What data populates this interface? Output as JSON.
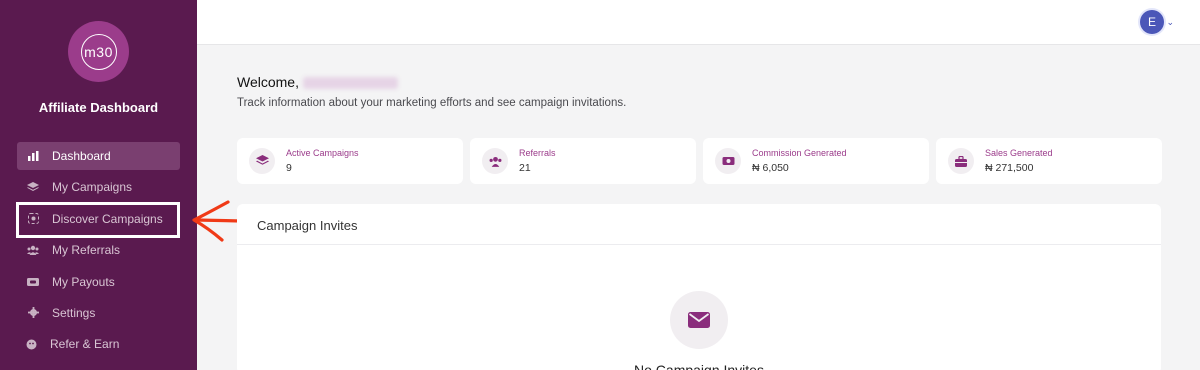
{
  "sidebar": {
    "logo_text": "m30",
    "brand": "Affiliate Dashboard",
    "items": [
      {
        "label": "Dashboard",
        "icon": "bar-chart-icon",
        "active": true
      },
      {
        "label": "My Campaigns",
        "icon": "layers-icon"
      },
      {
        "label": "Discover Campaigns",
        "icon": "target-icon"
      },
      {
        "label": "My Referrals",
        "icon": "users-icon"
      },
      {
        "label": "My Payouts",
        "icon": "wallet-icon"
      },
      {
        "label": "Settings",
        "icon": "gear-icon"
      },
      {
        "label": "Refer & Earn",
        "icon": "gift-icon"
      }
    ]
  },
  "topbar": {
    "avatar_initial": "E"
  },
  "main": {
    "welcome": "Welcome,",
    "subtitle": "Track information about your marketing efforts and see campaign invitations.",
    "stats": [
      {
        "label": "Active Campaigns",
        "value": "9",
        "icon": "layers-icon"
      },
      {
        "label": "Referrals",
        "value": "21",
        "icon": "users-icon"
      },
      {
        "label": "Commission Generated",
        "value": "₦ 6,050",
        "icon": "cash-icon"
      },
      {
        "label": "Sales Generated",
        "value": "₦ 271,500",
        "icon": "briefcase-icon"
      }
    ],
    "invites": {
      "title": "Campaign Invites",
      "empty_text": "No Campaign Invites"
    }
  },
  "colors": {
    "sidebar_bg": "#5a1a4f",
    "accent": "#9b3c8b",
    "annotation_arrow": "#f03a17"
  }
}
